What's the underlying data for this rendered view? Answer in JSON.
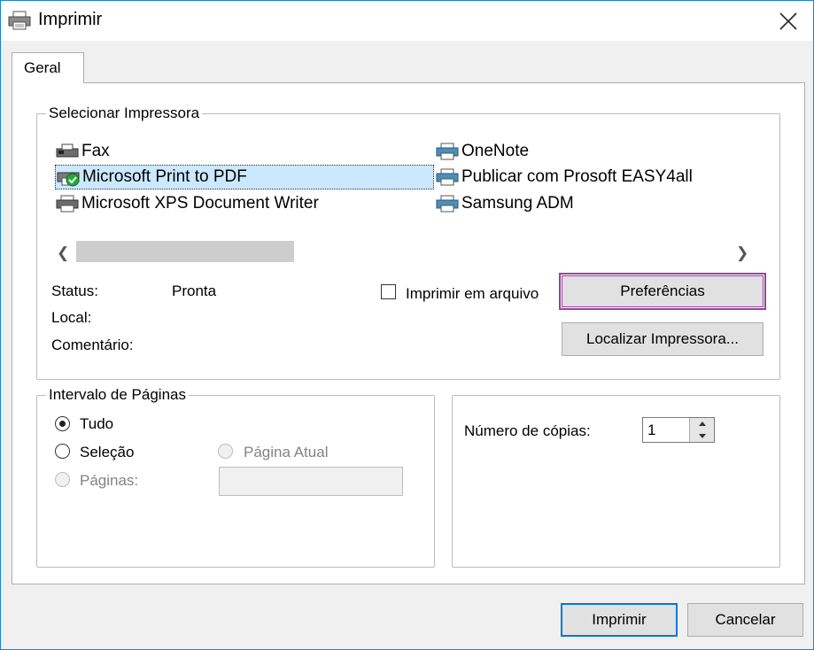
{
  "window": {
    "title": "Imprimir",
    "close_icon": "close-icon",
    "printer_icon": "printer-icon"
  },
  "tabs": [
    {
      "label": "Geral",
      "active": true
    }
  ],
  "select_printer": {
    "group_label": "Selecionar Impressora",
    "printers": [
      {
        "name": "Fax",
        "icon": "fax-icon",
        "selected": false
      },
      {
        "name": "Microsoft Print to PDF",
        "icon": "printer-default-icon",
        "selected": true
      },
      {
        "name": "Microsoft XPS Document Writer",
        "icon": "printer-icon",
        "selected": false
      },
      {
        "name": "OneNote",
        "icon": "printer-icon",
        "selected": false
      },
      {
        "name": "Publicar com Prosoft EASY4all",
        "icon": "printer-icon",
        "selected": false
      },
      {
        "name": "Samsung ADM",
        "icon": "printer-icon",
        "selected": false
      }
    ],
    "status_label": "Status:",
    "status_value": "Pronta",
    "location_label": "Local:",
    "comment_label": "Comentário:",
    "print_to_file_label": "Imprimir em arquivo",
    "print_to_file_checked": false,
    "preferences_button": "Preferências",
    "find_printer_button": "Localizar Impressora..."
  },
  "page_range": {
    "group_label": "Intervalo de Páginas",
    "all_label": "Tudo",
    "selection_label": "Seleção",
    "current_page_label": "Página Atual",
    "pages_label": "Páginas:",
    "pages_value": "",
    "selected_option": "Tudo"
  },
  "copies": {
    "label": "Número de cópias:",
    "value": "1"
  },
  "footer": {
    "print_button": "Imprimir",
    "cancel_button": "Cancelar"
  },
  "colors": {
    "accent": "#0078d7",
    "highlight_outline": "#9b3fa0",
    "selection_bg": "#cce8ff"
  }
}
